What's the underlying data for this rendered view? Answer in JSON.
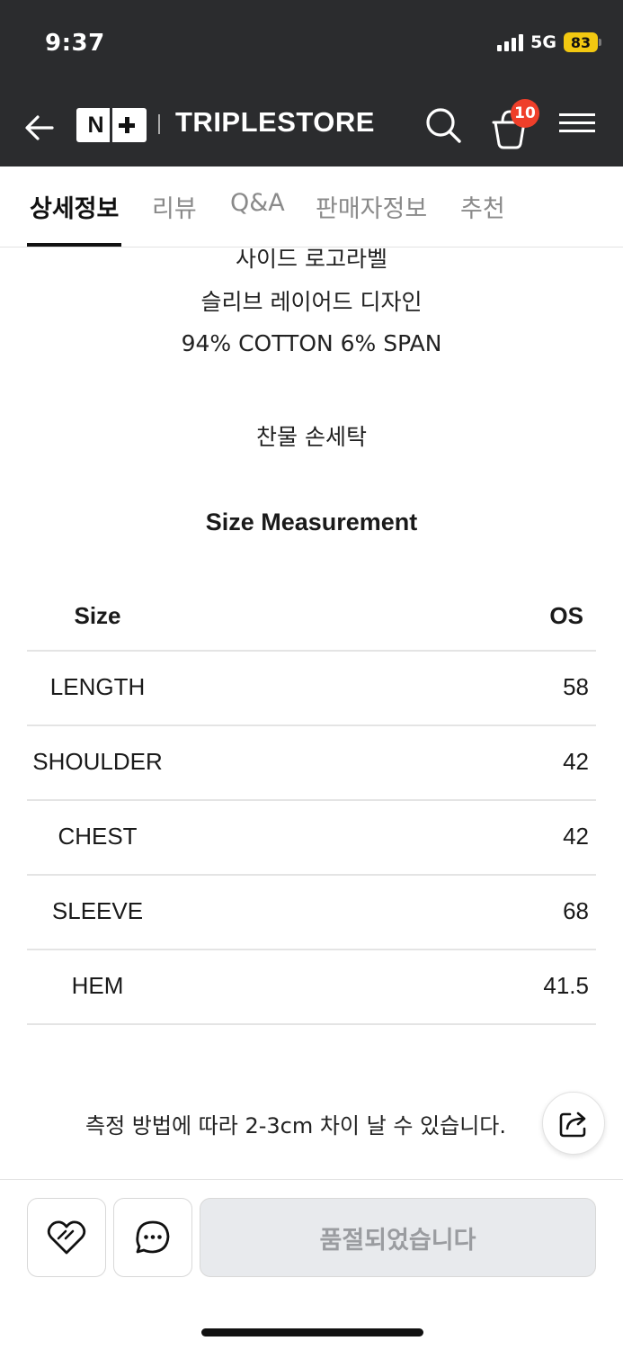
{
  "status_bar": {
    "time": "9:37",
    "network": "5G",
    "battery": "83"
  },
  "header": {
    "logo_n": "N",
    "brand": "TRIPLESTORE",
    "cart_count": "10",
    "icons": [
      "back-arrow-icon",
      "search-icon",
      "cart-icon",
      "menu-icon"
    ]
  },
  "tabs": [
    {
      "label": "상세정보",
      "active": true
    },
    {
      "label": "리뷰",
      "active": false
    },
    {
      "label": "Q&A",
      "active": false
    },
    {
      "label": "판매자정보",
      "active": false
    },
    {
      "label": "추천",
      "active": false
    }
  ],
  "description": {
    "lines": [
      "사이드 로고라벨",
      "슬리브 레이어드 디자인",
      "94% COTTON 6% SPAN",
      "찬물 손세탁"
    ]
  },
  "size_measurement": {
    "title": "Size Measurement",
    "columns": [
      "Size",
      "OS"
    ],
    "rows": [
      {
        "label": "LENGTH",
        "value": "58"
      },
      {
        "label": "SHOULDER",
        "value": "42"
      },
      {
        "label": "CHEST",
        "value": "42"
      },
      {
        "label": "SLEEVE",
        "value": "68"
      },
      {
        "label": "HEM",
        "value": "41.5"
      }
    ]
  },
  "note": "측정 방법에 따라 2-3cm 차이 날 수 있습니다.",
  "bottom_bar": {
    "soldout_label": "품절되었습니다",
    "icons": [
      "heart-icon",
      "chat-bubble-icon",
      "share-icon"
    ]
  },
  "colors": {
    "header_bg": "#2b2c2e",
    "badge": "#ef3f2a",
    "battery": "#f2c811",
    "disabled_button_bg": "#e8eaed"
  }
}
